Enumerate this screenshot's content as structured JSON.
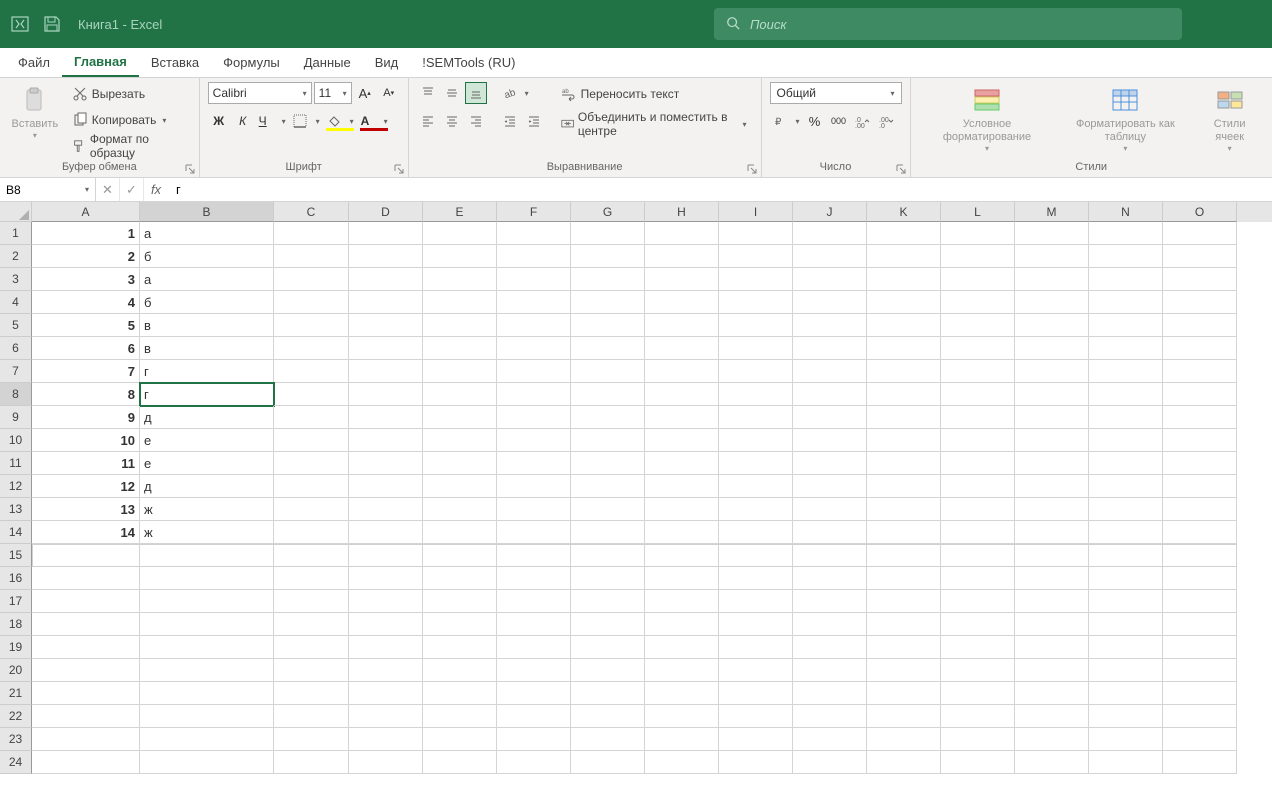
{
  "title": "Книга1 - Excel",
  "search_placeholder": "Поиск",
  "tabs": {
    "file": "Файл",
    "home": "Главная",
    "insert": "Вставка",
    "formulas": "Формулы",
    "data": "Данные",
    "view": "Вид",
    "semtools": "!SEMTools (RU)"
  },
  "ribbon": {
    "paste": "Вставить",
    "cut": "Вырезать",
    "copy": "Копировать",
    "format_painter": "Формат по образцу",
    "clipboard_group": "Буфер обмена",
    "font_name": "Calibri",
    "font_size": "11",
    "bold": "Ж",
    "italic": "К",
    "underline": "Ч",
    "font_group": "Шрифт",
    "wrap_text": "Переносить текст",
    "merge_center": "Объединить и поместить в центре",
    "alignment_group": "Выравнивание",
    "number_format": "Общий",
    "number_group": "Число",
    "cond_format": "Условное форматирование",
    "format_table": "Форматировать как таблицу",
    "cell_styles": "Стили ячеек",
    "styles_group": "Стили"
  },
  "formula_bar": {
    "name_box": "B8",
    "fx": "fx",
    "formula": "г"
  },
  "columns": [
    "A",
    "B",
    "C",
    "D",
    "E",
    "F",
    "G",
    "H",
    "I",
    "J",
    "K",
    "L",
    "M",
    "N",
    "O"
  ],
  "col_widths": {
    "A": "wA",
    "B": "wB",
    "C": "wC"
  },
  "rows": [
    1,
    2,
    3,
    4,
    5,
    6,
    7,
    8,
    9,
    10,
    11,
    12,
    13,
    14,
    15,
    16,
    17,
    18,
    19,
    20,
    21,
    22,
    23,
    24
  ],
  "data": {
    "1": {
      "A": "1",
      "B": "а"
    },
    "2": {
      "A": "2",
      "B": "б"
    },
    "3": {
      "A": "3",
      "B": "а"
    },
    "4": {
      "A": "4",
      "B": "б"
    },
    "5": {
      "A": "5",
      "B": "в"
    },
    "6": {
      "A": "6",
      "B": "в"
    },
    "7": {
      "A": "7",
      "B": "г"
    },
    "8": {
      "A": "8",
      "B": "г"
    },
    "9": {
      "A": "9",
      "B": "д"
    },
    "10": {
      "A": "10",
      "B": "е"
    },
    "11": {
      "A": "11",
      "B": "е"
    },
    "12": {
      "A": "12",
      "B": "д"
    },
    "13": {
      "A": "13",
      "B": "ж"
    },
    "14": {
      "A": "14",
      "B": "ж"
    }
  },
  "selected": {
    "row": 8,
    "col": "B"
  }
}
